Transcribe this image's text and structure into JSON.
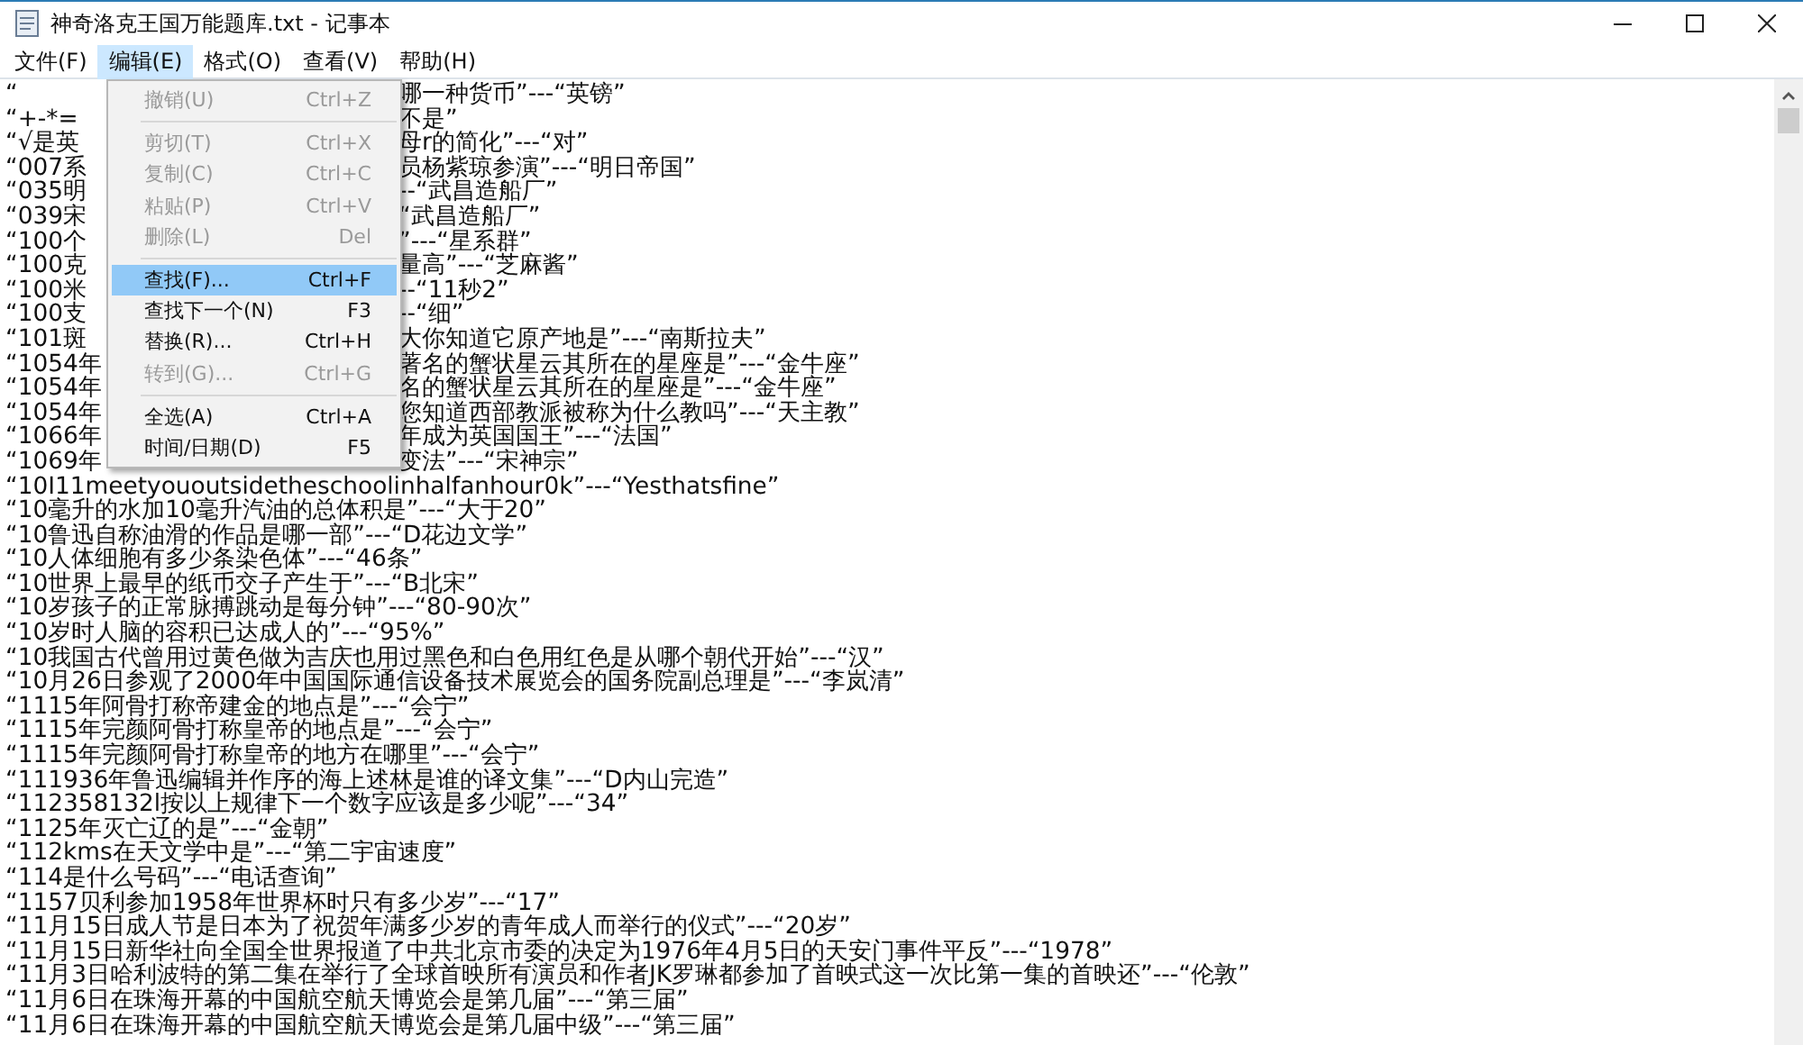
{
  "window": {
    "title": "神奇洛克王国万能题库.txt - 记事本"
  },
  "menu_bar": [
    {
      "label": "文件(F)",
      "selected": false
    },
    {
      "label": "编辑(E)",
      "selected": true
    },
    {
      "label": "格式(O)",
      "selected": false
    },
    {
      "label": "查看(V)",
      "selected": false
    },
    {
      "label": "帮助(H)",
      "selected": false
    }
  ],
  "edit_menu": [
    {
      "kind": "item",
      "label": "撤销(U)",
      "shortcut": "Ctrl+Z",
      "disabled": true,
      "selected": false
    },
    {
      "kind": "separator"
    },
    {
      "kind": "item",
      "label": "剪切(T)",
      "shortcut": "Ctrl+X",
      "disabled": true,
      "selected": false
    },
    {
      "kind": "item",
      "label": "复制(C)",
      "shortcut": "Ctrl+C",
      "disabled": true,
      "selected": false
    },
    {
      "kind": "item",
      "label": "粘贴(P)",
      "shortcut": "Ctrl+V",
      "disabled": true,
      "selected": false
    },
    {
      "kind": "item",
      "label": "删除(L)",
      "shortcut": "Del",
      "disabled": true,
      "selected": false
    },
    {
      "kind": "separator"
    },
    {
      "kind": "item",
      "label": "查找(F)...",
      "shortcut": "Ctrl+F",
      "disabled": false,
      "selected": true
    },
    {
      "kind": "item",
      "label": "查找下一个(N)",
      "shortcut": "F3",
      "disabled": false,
      "selected": false
    },
    {
      "kind": "item",
      "label": "替换(R)...",
      "shortcut": "Ctrl+H",
      "disabled": false,
      "selected": false
    },
    {
      "kind": "item",
      "label": "转到(G)...",
      "shortcut": "Ctrl+G",
      "disabled": true,
      "selected": false
    },
    {
      "kind": "separator"
    },
    {
      "kind": "item",
      "label": "全选(A)",
      "shortcut": "Ctrl+A",
      "disabled": false,
      "selected": false
    },
    {
      "kind": "item",
      "label": "时间/日期(D)",
      "shortcut": "F5",
      "disabled": false,
      "selected": false
    }
  ],
  "lines": [
    {
      "kind": "split",
      "left": "“",
      "right": "哪一种货币”---“英镑”"
    },
    {
      "kind": "split",
      "left": "“+-*=",
      "right": "不是”"
    },
    {
      "kind": "split",
      "left": "“√是英",
      "right": "母r的简化”---“对”"
    },
    {
      "kind": "split",
      "left": "“007系",
      "right": "员杨紫琼参演”---“明日帝国”"
    },
    {
      "kind": "split",
      "left": "“035明",
      "right": "--“武昌造船厂”"
    },
    {
      "kind": "split",
      "left": "“039宋",
      "right": "“武昌造船厂”"
    },
    {
      "kind": "split",
      "left": "“100个",
      "right": "”---“星系群”"
    },
    {
      "kind": "split",
      "left": "“100克",
      "right": "量高”---“芝麻酱”"
    },
    {
      "kind": "split",
      "left": "“100米",
      "right": "--“11秒2”"
    },
    {
      "kind": "split",
      "left": "“100支",
      "right": "--“细”"
    },
    {
      "kind": "split",
      "left": "“101斑",
      "right": "大你知道它原产地是”---“南斯拉夫”"
    },
    {
      "kind": "split",
      "left": "“1054年",
      "right": "著名的蟹状星云其所在的星座是”---“金牛座”"
    },
    {
      "kind": "split",
      "left": "“1054年",
      "right": "名的蟹状星云其所在的星座是”---“金牛座”"
    },
    {
      "kind": "split",
      "left": "“1054年",
      "right": "您知道西部教派被称为什么教吗”---“天主教”"
    },
    {
      "kind": "split",
      "left": "“1066年",
      "right": "年成为英国国王”---“法国”"
    },
    {
      "kind": "split",
      "left": "“1069年",
      "right": "变法”---“宋神宗”"
    },
    {
      "kind": "full",
      "text": "“10I11meetyououtsidetheschoolinhalfanhour0k”---“Yesthatsfine”"
    },
    {
      "kind": "full",
      "text": "“10毫升的水加10毫升汽油的总体积是”---“大于20”"
    },
    {
      "kind": "full",
      "text": "“10鲁迅自称油滑的作品是哪一部”---“D花边文学”"
    },
    {
      "kind": "full",
      "text": "“10人体细胞有多少条染色体”---“46条”"
    },
    {
      "kind": "full",
      "text": "“10世界上最早的纸币交子产生于”---“B北宋”"
    },
    {
      "kind": "full",
      "text": "“10岁孩子的正常脉搏跳动是每分钟”---“80-90次”"
    },
    {
      "kind": "full",
      "text": "“10岁时人脑的容积已达成人的”---“95%”"
    },
    {
      "kind": "full",
      "text": "“10我国古代曾用过黄色做为吉庆也用过黑色和白色用红色是从哪个朝代开始”---“汉”"
    },
    {
      "kind": "full",
      "text": "“10月26日参观了2000年中国国际通信设备技术展览会的国务院副总理是”---“李岚清”"
    },
    {
      "kind": "full",
      "text": "“1115年阿骨打称帝建金的地点是”---“会宁”"
    },
    {
      "kind": "full",
      "text": "“1115年完颜阿骨打称皇帝的地点是”---“会宁”"
    },
    {
      "kind": "full",
      "text": "“1115年完颜阿骨打称皇帝的地方在哪里”---“会宁”"
    },
    {
      "kind": "full",
      "text": "“111936年鲁迅编辑并作序的海上述林是谁的译文集”---“D内山完造”"
    },
    {
      "kind": "full",
      "text": "“112358132l按以上规律下一个数字应该是多少呢”---“34”"
    },
    {
      "kind": "full",
      "text": "“1125年灭亡辽的是”---“金朝”"
    },
    {
      "kind": "full",
      "text": "“112kms在天文学中是”---“第二宇宙速度”"
    },
    {
      "kind": "full",
      "text": "“114是什么号码”---“电话查询”"
    },
    {
      "kind": "full",
      "text": "“1157贝利参加1958年世界杯时只有多少岁”---“17”"
    },
    {
      "kind": "full",
      "text": "“11月15日成人节是日本为了祝贺年满多少岁的青年成人而举行的仪式”---“20岁”"
    },
    {
      "kind": "full",
      "text": "“11月15日新华社向全国全世界报道了中共北京市委的决定为1976年4月5日的天安门事件平反”---“1978”"
    },
    {
      "kind": "full",
      "text": "“11月3日哈利波特的第二集在举行了全球首映所有演员和作者JK罗琳都参加了首映式这一次比第一集的首映还”---“伦敦”"
    },
    {
      "kind": "full",
      "text": "“11月6日在珠海开幕的中国航空航天博览会是第几届”---“第三届”"
    },
    {
      "kind": "full",
      "text": "“11月6日在珠海开幕的中国航空航天博览会是第几届中级”---“第三届”"
    }
  ]
}
